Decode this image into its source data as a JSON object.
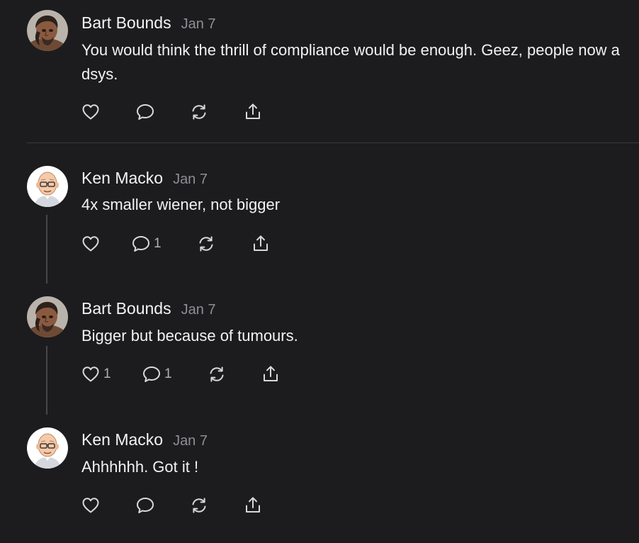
{
  "comments": [
    {
      "author": "Bart Bounds",
      "date": "Jan 7",
      "avatar_icon": "caveman-avatar-icon",
      "text": "You would think the thrill of compliance would be enough. Geez, people now a dsys.",
      "likes": "",
      "replies": ""
    },
    {
      "author": "Ken Macko",
      "date": "Jan 7",
      "avatar_icon": "bald-glasses-man-avatar-icon",
      "text": "4x smaller wiener, not bigger",
      "likes": "",
      "replies": "1"
    },
    {
      "author": "Bart Bounds",
      "date": "Jan 7",
      "avatar_icon": "caveman-avatar-icon",
      "text": "Bigger but because of tumours.",
      "likes": "1",
      "replies": "1"
    },
    {
      "author": "Ken Macko",
      "date": "Jan 7",
      "avatar_icon": "bald-glasses-man-avatar-icon",
      "text": "Ahhhhhh. Got it !",
      "likes": "",
      "replies": ""
    }
  ],
  "icons": {
    "like": "heart-icon",
    "reply": "comment-bubble-icon",
    "restack": "restack-icon",
    "share": "share-icon"
  },
  "colors": {
    "background": "#1c1c1e",
    "text": "#f2f2f2",
    "muted": "#8e8e93",
    "icon": "#d9d9dc"
  }
}
